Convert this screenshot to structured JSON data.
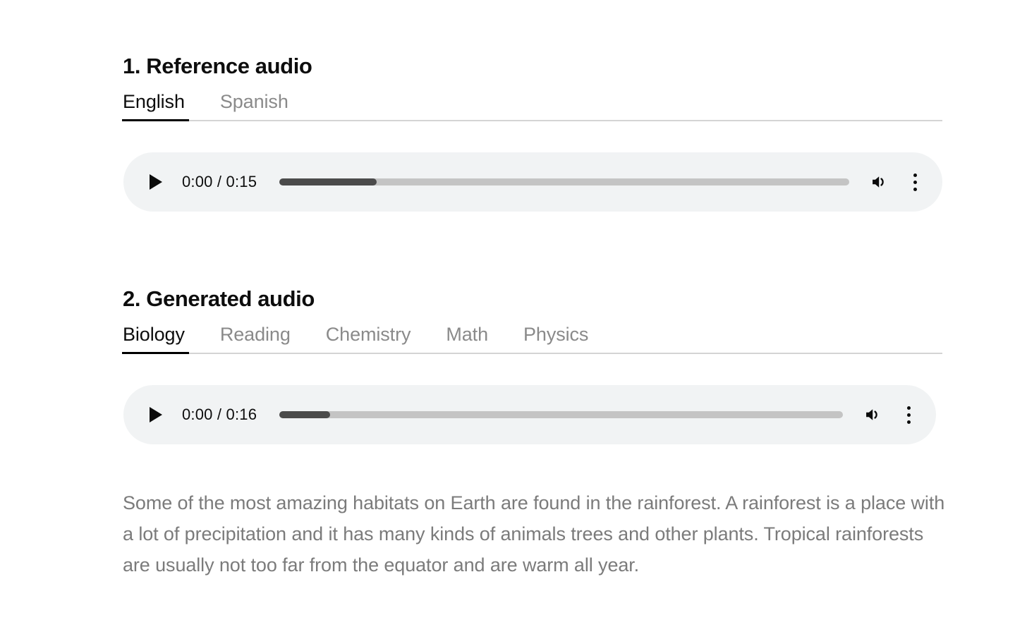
{
  "sections": [
    {
      "heading": "1. Reference audio",
      "tabs": [
        {
          "label": "English",
          "active": true
        },
        {
          "label": "Spanish",
          "active": false
        }
      ],
      "player": {
        "play_label": "Play",
        "time": "0:00 / 0:15",
        "current_time": "0:00",
        "duration": "0:15",
        "buffered_percent": 17,
        "progress_percent": 0,
        "volume_icon": "volume-on-icon",
        "menu_icon": "more-options-icon"
      }
    },
    {
      "heading": "2. Generated audio",
      "tabs": [
        {
          "label": "Biology",
          "active": true
        },
        {
          "label": "Reading",
          "active": false
        },
        {
          "label": "Chemistry",
          "active": false
        },
        {
          "label": "Math",
          "active": false
        },
        {
          "label": "Physics",
          "active": false
        }
      ],
      "player": {
        "play_label": "Play",
        "time": "0:00 / 0:16",
        "current_time": "0:00",
        "duration": "0:16",
        "buffered_percent": 9,
        "progress_percent": 0,
        "volume_icon": "volume-on-icon",
        "menu_icon": "more-options-icon"
      },
      "transcript": "Some of the most amazing habitats on Earth are found in the rainforest. A rainforest is a place with a lot of precipitation and it has many kinds of animals trees and other plants. Tropical rainforests are usually not too far from the equator and are warm all year."
    }
  ],
  "colors": {
    "text_primary": "#0d0d0d",
    "text_muted": "#7b7b7b",
    "tab_inactive": "#8a8a8a",
    "player_bg": "#f1f3f4",
    "track": "#c4c4c4",
    "buffered": "#4b4b4b",
    "divider": "#d4d4d4",
    "active_underline": "#000000"
  }
}
